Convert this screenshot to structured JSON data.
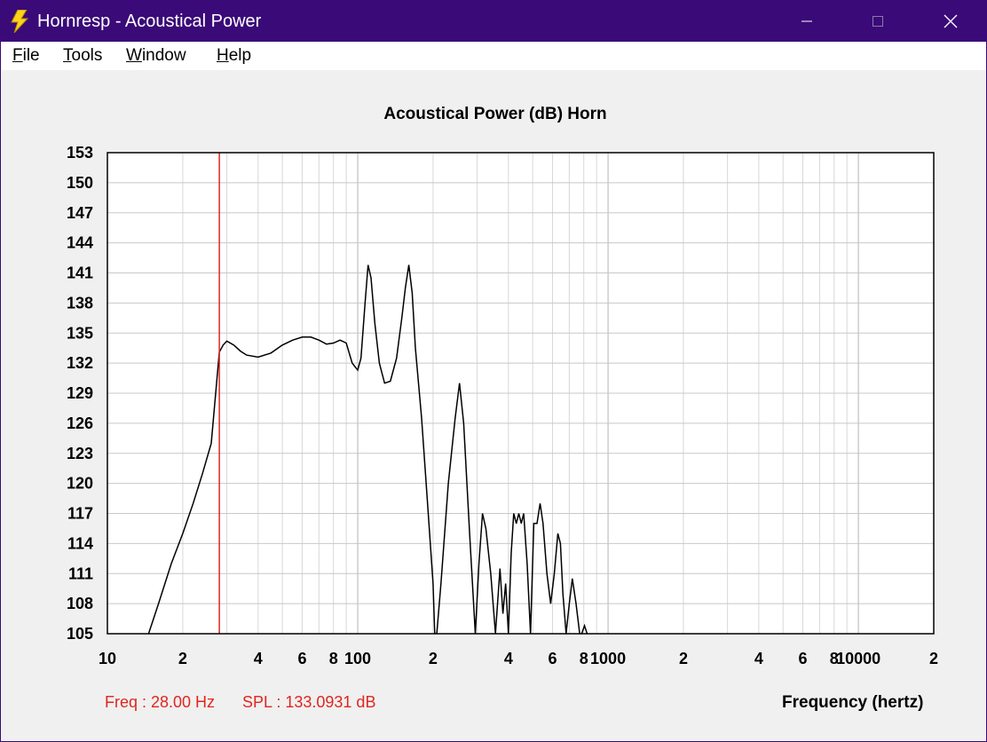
{
  "window": {
    "title": "Hornresp - Acoustical Power",
    "icon": "lightning-bolt-icon",
    "controls": [
      "minimize-icon",
      "maximize-icon",
      "close-icon"
    ],
    "titlebar_color": "#3a0a78"
  },
  "menu": [
    {
      "label": "File",
      "accel": "F",
      "rest": "ile"
    },
    {
      "label": "Tools",
      "accel": "T",
      "rest": "ools"
    },
    {
      "label": "Window",
      "accel": "W",
      "rest": "indow"
    },
    {
      "label": "Help",
      "accel": "H",
      "rest": "elp"
    }
  ],
  "status": {
    "freq": "Freq : 28.00 Hz",
    "spl": "SPL : 133.0931 dB",
    "color": "#e0261f"
  },
  "chart_data": {
    "type": "line",
    "title": "Acoustical Power (dB)    Horn",
    "xlabel": "Frequency (hertz)",
    "ylabel": "",
    "x_scale": "log",
    "xlim": [
      10,
      20000
    ],
    "ylim": [
      105,
      153
    ],
    "yticks": [
      153,
      150,
      147,
      144,
      141,
      138,
      135,
      132,
      129,
      126,
      123,
      120,
      117,
      114,
      111,
      108,
      105
    ],
    "xtick_labels": [
      {
        "x": 10,
        "label": "10"
      },
      {
        "x": 20,
        "label": "2"
      },
      {
        "x": 40,
        "label": "4"
      },
      {
        "x": 60,
        "label": "6"
      },
      {
        "x": 80,
        "label": "8"
      },
      {
        "x": 100,
        "label": "100"
      },
      {
        "x": 200,
        "label": "2"
      },
      {
        "x": 400,
        "label": "4"
      },
      {
        "x": 600,
        "label": "6"
      },
      {
        "x": 800,
        "label": "8"
      },
      {
        "x": 1000,
        "label": "1000"
      },
      {
        "x": 2000,
        "label": "2"
      },
      {
        "x": 4000,
        "label": "4"
      },
      {
        "x": 6000,
        "label": "6"
      },
      {
        "x": 8000,
        "label": "8"
      },
      {
        "x": 10000,
        "label": "10000"
      },
      {
        "x": 20000,
        "label": "2"
      }
    ],
    "grid": true,
    "marker": {
      "x": 28,
      "color": "#e0261f"
    },
    "series": [
      {
        "color": "#000000",
        "points": [
          [
            14.6,
            105.0
          ],
          [
            16,
            108
          ],
          [
            18,
            112
          ],
          [
            20,
            115
          ],
          [
            22,
            118
          ],
          [
            24,
            121
          ],
          [
            26,
            124
          ],
          [
            28,
            133.1
          ],
          [
            29,
            133.8
          ],
          [
            30,
            134.2
          ],
          [
            32,
            133.8
          ],
          [
            34,
            133.2
          ],
          [
            36,
            132.8
          ],
          [
            40,
            132.6
          ],
          [
            45,
            133.0
          ],
          [
            50,
            133.8
          ],
          [
            55,
            134.3
          ],
          [
            60,
            134.6
          ],
          [
            65,
            134.6
          ],
          [
            70,
            134.3
          ],
          [
            75,
            133.9
          ],
          [
            80,
            134.0
          ],
          [
            85,
            134.3
          ],
          [
            90,
            134.0
          ],
          [
            95,
            132.0
          ],
          [
            100,
            131.3
          ],
          [
            103,
            132.5
          ],
          [
            107,
            138.0
          ],
          [
            110,
            141.8
          ],
          [
            113,
            140.5
          ],
          [
            117,
            136.0
          ],
          [
            122,
            132.0
          ],
          [
            128,
            130.0
          ],
          [
            135,
            130.2
          ],
          [
            143,
            132.5
          ],
          [
            150,
            136.5
          ],
          [
            155,
            139.5
          ],
          [
            160,
            141.8
          ],
          [
            165,
            139.0
          ],
          [
            170,
            133.5
          ],
          [
            180,
            126.5
          ],
          [
            190,
            118.0
          ],
          [
            200,
            110.0
          ],
          [
            203,
            105.0
          ],
          [
            207,
            105.0
          ],
          [
            215,
            110.0
          ],
          [
            230,
            120.0
          ],
          [
            245,
            126.5
          ],
          [
            255,
            130.0
          ],
          [
            265,
            126.0
          ],
          [
            280,
            115.0
          ],
          [
            295,
            105.0
          ],
          [
            305,
            112.0
          ],
          [
            315,
            117.0
          ],
          [
            325,
            115.5
          ],
          [
            340,
            111.0
          ],
          [
            355,
            105.0
          ],
          [
            370,
            111.5
          ],
          [
            380,
            107.0
          ],
          [
            390,
            110.0
          ],
          [
            400,
            105.0
          ],
          [
            410,
            113.0
          ],
          [
            420,
            117.0
          ],
          [
            430,
            116.0
          ],
          [
            440,
            117.0
          ],
          [
            450,
            116.0
          ],
          [
            460,
            117.0
          ],
          [
            475,
            112.0
          ],
          [
            490,
            105.0
          ],
          [
            505,
            116.0
          ],
          [
            520,
            116.0
          ],
          [
            535,
            118.0
          ],
          [
            550,
            116.0
          ],
          [
            570,
            111.0
          ],
          [
            590,
            108.0
          ],
          [
            610,
            111.0
          ],
          [
            630,
            115.0
          ],
          [
            645,
            114.0
          ],
          [
            660,
            109.0
          ],
          [
            680,
            105.0
          ],
          [
            700,
            108.0
          ],
          [
            720,
            110.5
          ],
          [
            745,
            108.0
          ],
          [
            770,
            105.0
          ],
          [
            785,
            105.0
          ],
          [
            805,
            105.8
          ],
          [
            825,
            105.0
          ]
        ]
      }
    ]
  }
}
